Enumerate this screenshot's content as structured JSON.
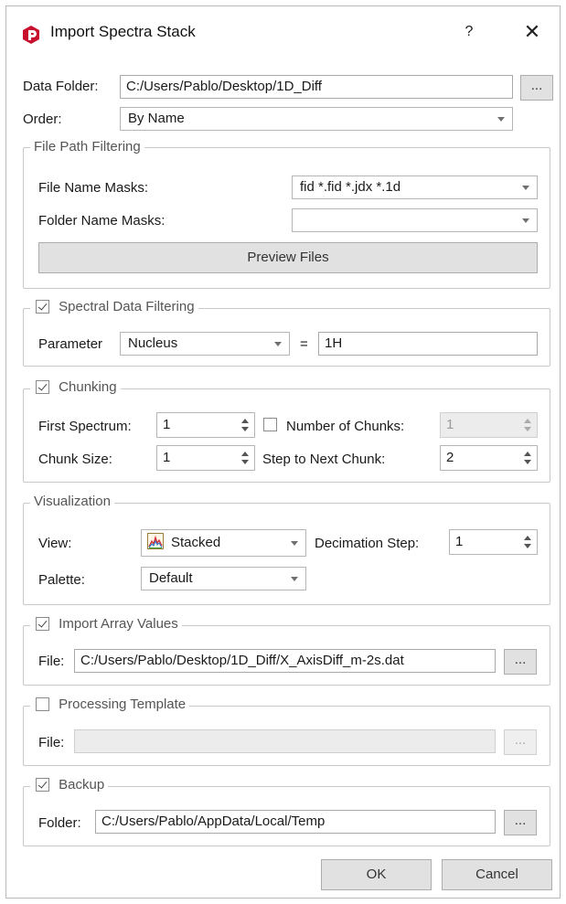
{
  "window": {
    "title": "Import Spectra Stack",
    "help_label": "?",
    "close_label": "✕",
    "icon": "app-logo-icon",
    "accent_color": "#c8102e"
  },
  "data_folder": {
    "label": "Data Folder:",
    "value": "C:/Users/Pablo/Desktop/1D_Diff",
    "browse_label": "..."
  },
  "order": {
    "label": "Order:",
    "value": "By Name"
  },
  "file_path_filtering": {
    "title": "File Path Filtering",
    "file_masks_label": "File Name Masks:",
    "file_masks_value": "fid *.fid *.jdx *.1d",
    "folder_masks_label": "Folder Name Masks:",
    "folder_masks_value": "",
    "preview_label": "Preview Files"
  },
  "spectral_filtering": {
    "title": "Spectral Data Filtering",
    "checked": true,
    "parameter_label": "Parameter",
    "parameter_value": "Nucleus",
    "equals": "=",
    "value": "1H"
  },
  "chunking": {
    "title": "Chunking",
    "checked": true,
    "first_spectrum_label": "First Spectrum:",
    "first_spectrum_value": "1",
    "num_chunks_label": "Number of Chunks:",
    "num_chunks_checked": false,
    "num_chunks_value": "1",
    "chunk_size_label": "Chunk Size:",
    "chunk_size_value": "1",
    "step_label": "Step to Next Chunk:",
    "step_value": "2"
  },
  "visualization": {
    "title": "Visualization",
    "view_label": "View:",
    "view_value": "Stacked",
    "view_icon": "stacked-chart-icon",
    "decimation_label": "Decimation Step:",
    "decimation_value": "1",
    "palette_label": "Palette:",
    "palette_value": "Default"
  },
  "array_values": {
    "title": "Import Array Values",
    "checked": true,
    "file_label": "File:",
    "file_value": "C:/Users/Pablo/Desktop/1D_Diff/X_AxisDiff_m-2s.dat",
    "browse_label": "..."
  },
  "processing_template": {
    "title": "Processing Template",
    "checked": false,
    "file_label": "File:",
    "file_value": "",
    "browse_label": "..."
  },
  "backup": {
    "title": "Backup",
    "checked": true,
    "folder_label": "Folder:",
    "folder_value": "C:/Users/Pablo/AppData/Local/Temp",
    "browse_label": "..."
  },
  "buttons": {
    "ok_label": "OK",
    "cancel_label": "Cancel"
  }
}
